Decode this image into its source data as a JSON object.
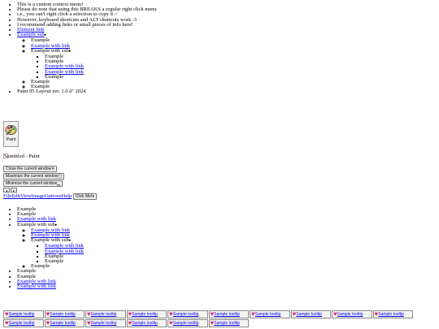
{
  "context_menu": {
    "notes": [
      "This is a custom context menu!",
      "Please do note that using this BREAKS a regular right click menu",
      "i.e., you can't right click a selection to copy it :/",
      "However, keyboard shortcuts and ALT shortcuts work :3",
      "I recommend adding links or small pieces of info here!"
    ],
    "element_link": "Element link",
    "example_sub": "Example sub",
    "example": "Example",
    "example_with_link": "Example with link",
    "example_with_sub": "Example with sub",
    "footer": "Paint 95 Layout ver. 1.0 â“ 2024"
  },
  "desktop_icon": {
    "label": "Paint",
    "icon": "paint-palette-icon"
  },
  "window": {
    "title": "untitled - Paint",
    "close_label": "Close the current window",
    "maximize_label": "Maximize the current window",
    "minimize_label": "Minimize the current window",
    "arrow_left": "◂",
    "arrow_right": "▸"
  },
  "menubar": {
    "items": [
      "File",
      "Edit",
      "View",
      "Image",
      "Options",
      "Help"
    ],
    "click_me": "Click Me!"
  },
  "menu_list": {
    "example": "Example",
    "example_with_link": "Example with link",
    "example_with_sub": "Example with sub"
  },
  "tooltip_label": "Sample tooltip",
  "colors": {
    "link": "#0000ee",
    "heart": "#e0286e"
  }
}
